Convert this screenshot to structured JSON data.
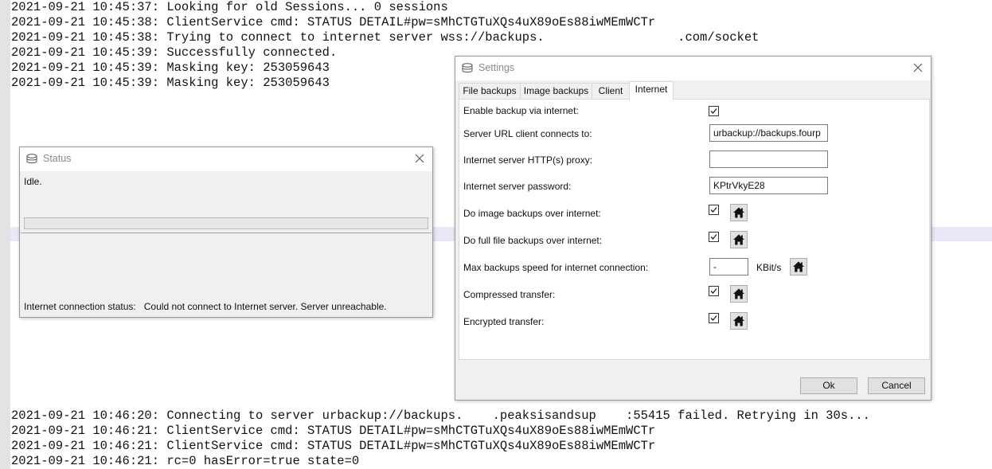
{
  "console": {
    "top_lines": [
      "2021-09-21 10:45:37: Looking for old Sessions... 0 sessions",
      "2021-09-21 10:45:38: ClientService cmd: STATUS DETAIL#pw=sMhCTGTuXQs4uX89oEs88iwMEmWCTr",
      "2021-09-21 10:45:38: Trying to connect to internet server wss://backups.                  .com/socket",
      "2021-09-21 10:45:39: Successfully connected.",
      "2021-09-21 10:45:39: Masking key: 253059643",
      "2021-09-21 10:45:39: Masking key: 253059643"
    ],
    "bottom_lines": [
      "2021-09-21 10:46:20: Connecting to server urbackup://backups.    .peaksisandsup    :55415 failed. Retrying in 30s...",
      "2021-09-21 10:46:21: ClientService cmd: STATUS DETAIL#pw=sMhCTGTuXQs4uX89oEs88iwMEmWCTr",
      "2021-09-21 10:46:21: ClientService cmd: STATUS DETAIL#pw=sMhCTGTuXQs4uX89oEs88iwMEmWCTr",
      "2021-09-21 10:46:21: rc=0 hasError=true state=0"
    ]
  },
  "status_window": {
    "title": "Status",
    "state_text": "Idle.",
    "progress": 0,
    "internet_status_label": "Internet connection status:",
    "internet_status_value": "Could not connect to Internet server. Server unreachable."
  },
  "settings_window": {
    "title": "Settings",
    "tabs": [
      "File backups",
      "Image backups",
      "Client",
      "Internet"
    ],
    "active_tab": "Internet",
    "rows": {
      "enable_backup": {
        "label": "Enable backup via internet:",
        "checked": true
      },
      "server_url": {
        "label": "Server URL client connects to:",
        "value": "urbackup://backups.fourp"
      },
      "proxy": {
        "label": "Internet server HTTP(s) proxy:",
        "value": ""
      },
      "password": {
        "label": "Internet server password:",
        "value": "KPtrVkyE28"
      },
      "image_backups": {
        "label": "Do image backups over internet:",
        "checked": true
      },
      "full_file_backups": {
        "label": "Do full file backups over internet:",
        "checked": true
      },
      "max_speed": {
        "label": "Max backups speed for internet connection:",
        "value": "-",
        "unit": "KBit/s"
      },
      "compressed": {
        "label": "Compressed transfer:",
        "checked": true
      },
      "encrypted": {
        "label": "Encrypted transfer:",
        "checked": true
      }
    },
    "ok_label": "Ok",
    "cancel_label": "Cancel"
  },
  "icons": {
    "window_icon": "database-icon",
    "close": "close-icon",
    "house": "home-icon",
    "check": "checkmark-icon"
  }
}
